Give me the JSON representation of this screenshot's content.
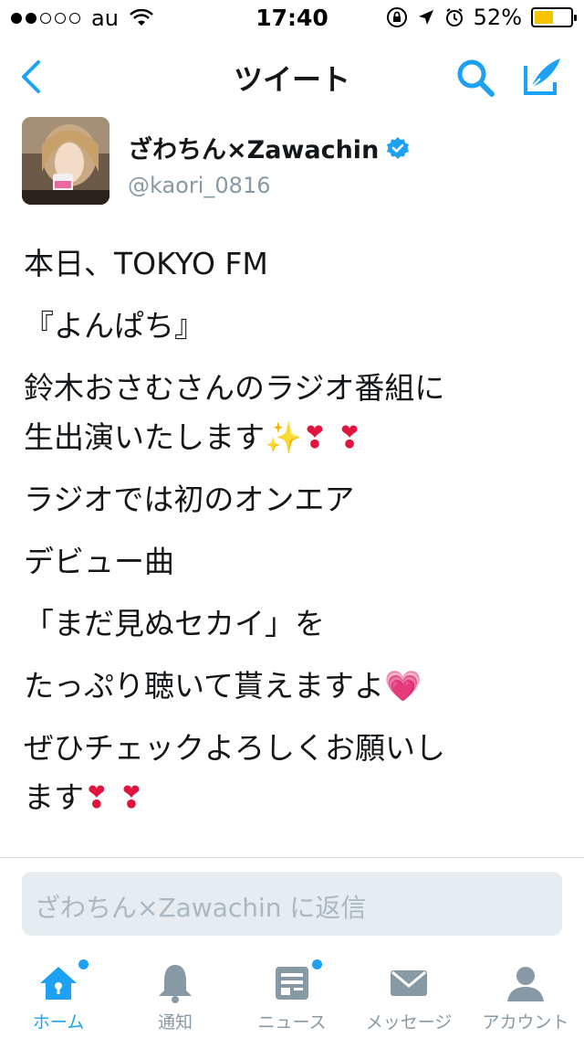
{
  "status_bar": {
    "carrier": "au",
    "time": "17:40",
    "battery_percent": "52%",
    "battery_level": 0.52,
    "signal_bars_filled": 2,
    "signal_bars_total": 5
  },
  "nav": {
    "title": "ツイート",
    "icons": [
      "back-chevron-icon",
      "search-icon",
      "compose-tweet-icon"
    ]
  },
  "tweet": {
    "author_name": "ざわちん×Zawachin",
    "author_handle": "@kaori_0816",
    "verified": true,
    "lines": {
      "l1": "本日、TOKYO FM",
      "l2": "『よんぱち』",
      "l3": "鈴木おさむさんのラジオ番組に",
      "l4": "生出演いたします",
      "l5": "ラジオでは初のオンエア",
      "l6": "デビュー曲",
      "l7": "「まだ見ぬセカイ」を",
      "l8": "たっぷり聴いて貰えますよ",
      "l9": "ぜひチェックよろしくお願いし",
      "l10": "ます"
    },
    "emoji": {
      "sparkles": "✨",
      "heart": "❣",
      "pink_heart": "💗"
    }
  },
  "reply": {
    "placeholder": "ざわちん×Zawachin に返信"
  },
  "tab_bar": {
    "items": [
      {
        "label": "ホーム",
        "icon": "home-icon",
        "active": true,
        "badge": true
      },
      {
        "label": "通知",
        "icon": "bell-icon",
        "active": false,
        "badge": false
      },
      {
        "label": "ニュース",
        "icon": "news-icon",
        "active": false,
        "badge": true
      },
      {
        "label": "メッセージ",
        "icon": "envelope-icon",
        "active": false,
        "badge": false
      },
      {
        "label": "アカウント",
        "icon": "person-icon",
        "active": false,
        "badge": false
      }
    ]
  },
  "colors": {
    "accent": "#1da1f2",
    "inactive": "#8899a6",
    "battery_fill": "#f5c400"
  }
}
